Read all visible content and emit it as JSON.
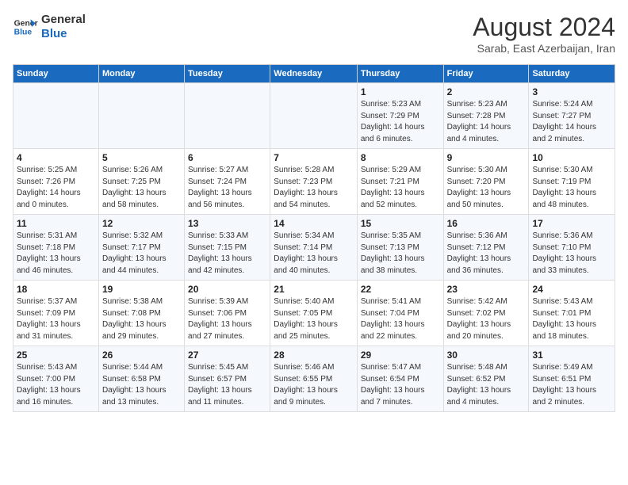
{
  "header": {
    "logo_line1": "General",
    "logo_line2": "Blue",
    "month_year": "August 2024",
    "location": "Sarab, East Azerbaijan, Iran"
  },
  "days_of_week": [
    "Sunday",
    "Monday",
    "Tuesday",
    "Wednesday",
    "Thursday",
    "Friday",
    "Saturday"
  ],
  "weeks": [
    [
      {
        "day": "",
        "detail": ""
      },
      {
        "day": "",
        "detail": ""
      },
      {
        "day": "",
        "detail": ""
      },
      {
        "day": "",
        "detail": ""
      },
      {
        "day": "1",
        "detail": "Sunrise: 5:23 AM\nSunset: 7:29 PM\nDaylight: 14 hours\nand 6 minutes."
      },
      {
        "day": "2",
        "detail": "Sunrise: 5:23 AM\nSunset: 7:28 PM\nDaylight: 14 hours\nand 4 minutes."
      },
      {
        "day": "3",
        "detail": "Sunrise: 5:24 AM\nSunset: 7:27 PM\nDaylight: 14 hours\nand 2 minutes."
      }
    ],
    [
      {
        "day": "4",
        "detail": "Sunrise: 5:25 AM\nSunset: 7:26 PM\nDaylight: 14 hours\nand 0 minutes."
      },
      {
        "day": "5",
        "detail": "Sunrise: 5:26 AM\nSunset: 7:25 PM\nDaylight: 13 hours\nand 58 minutes."
      },
      {
        "day": "6",
        "detail": "Sunrise: 5:27 AM\nSunset: 7:24 PM\nDaylight: 13 hours\nand 56 minutes."
      },
      {
        "day": "7",
        "detail": "Sunrise: 5:28 AM\nSunset: 7:23 PM\nDaylight: 13 hours\nand 54 minutes."
      },
      {
        "day": "8",
        "detail": "Sunrise: 5:29 AM\nSunset: 7:21 PM\nDaylight: 13 hours\nand 52 minutes."
      },
      {
        "day": "9",
        "detail": "Sunrise: 5:30 AM\nSunset: 7:20 PM\nDaylight: 13 hours\nand 50 minutes."
      },
      {
        "day": "10",
        "detail": "Sunrise: 5:30 AM\nSunset: 7:19 PM\nDaylight: 13 hours\nand 48 minutes."
      }
    ],
    [
      {
        "day": "11",
        "detail": "Sunrise: 5:31 AM\nSunset: 7:18 PM\nDaylight: 13 hours\nand 46 minutes."
      },
      {
        "day": "12",
        "detail": "Sunrise: 5:32 AM\nSunset: 7:17 PM\nDaylight: 13 hours\nand 44 minutes."
      },
      {
        "day": "13",
        "detail": "Sunrise: 5:33 AM\nSunset: 7:15 PM\nDaylight: 13 hours\nand 42 minutes."
      },
      {
        "day": "14",
        "detail": "Sunrise: 5:34 AM\nSunset: 7:14 PM\nDaylight: 13 hours\nand 40 minutes."
      },
      {
        "day": "15",
        "detail": "Sunrise: 5:35 AM\nSunset: 7:13 PM\nDaylight: 13 hours\nand 38 minutes."
      },
      {
        "day": "16",
        "detail": "Sunrise: 5:36 AM\nSunset: 7:12 PM\nDaylight: 13 hours\nand 36 minutes."
      },
      {
        "day": "17",
        "detail": "Sunrise: 5:36 AM\nSunset: 7:10 PM\nDaylight: 13 hours\nand 33 minutes."
      }
    ],
    [
      {
        "day": "18",
        "detail": "Sunrise: 5:37 AM\nSunset: 7:09 PM\nDaylight: 13 hours\nand 31 minutes."
      },
      {
        "day": "19",
        "detail": "Sunrise: 5:38 AM\nSunset: 7:08 PM\nDaylight: 13 hours\nand 29 minutes."
      },
      {
        "day": "20",
        "detail": "Sunrise: 5:39 AM\nSunset: 7:06 PM\nDaylight: 13 hours\nand 27 minutes."
      },
      {
        "day": "21",
        "detail": "Sunrise: 5:40 AM\nSunset: 7:05 PM\nDaylight: 13 hours\nand 25 minutes."
      },
      {
        "day": "22",
        "detail": "Sunrise: 5:41 AM\nSunset: 7:04 PM\nDaylight: 13 hours\nand 22 minutes."
      },
      {
        "day": "23",
        "detail": "Sunrise: 5:42 AM\nSunset: 7:02 PM\nDaylight: 13 hours\nand 20 minutes."
      },
      {
        "day": "24",
        "detail": "Sunrise: 5:43 AM\nSunset: 7:01 PM\nDaylight: 13 hours\nand 18 minutes."
      }
    ],
    [
      {
        "day": "25",
        "detail": "Sunrise: 5:43 AM\nSunset: 7:00 PM\nDaylight: 13 hours\nand 16 minutes."
      },
      {
        "day": "26",
        "detail": "Sunrise: 5:44 AM\nSunset: 6:58 PM\nDaylight: 13 hours\nand 13 minutes."
      },
      {
        "day": "27",
        "detail": "Sunrise: 5:45 AM\nSunset: 6:57 PM\nDaylight: 13 hours\nand 11 minutes."
      },
      {
        "day": "28",
        "detail": "Sunrise: 5:46 AM\nSunset: 6:55 PM\nDaylight: 13 hours\nand 9 minutes."
      },
      {
        "day": "29",
        "detail": "Sunrise: 5:47 AM\nSunset: 6:54 PM\nDaylight: 13 hours\nand 7 minutes."
      },
      {
        "day": "30",
        "detail": "Sunrise: 5:48 AM\nSunset: 6:52 PM\nDaylight: 13 hours\nand 4 minutes."
      },
      {
        "day": "31",
        "detail": "Sunrise: 5:49 AM\nSunset: 6:51 PM\nDaylight: 13 hours\nand 2 minutes."
      }
    ]
  ]
}
